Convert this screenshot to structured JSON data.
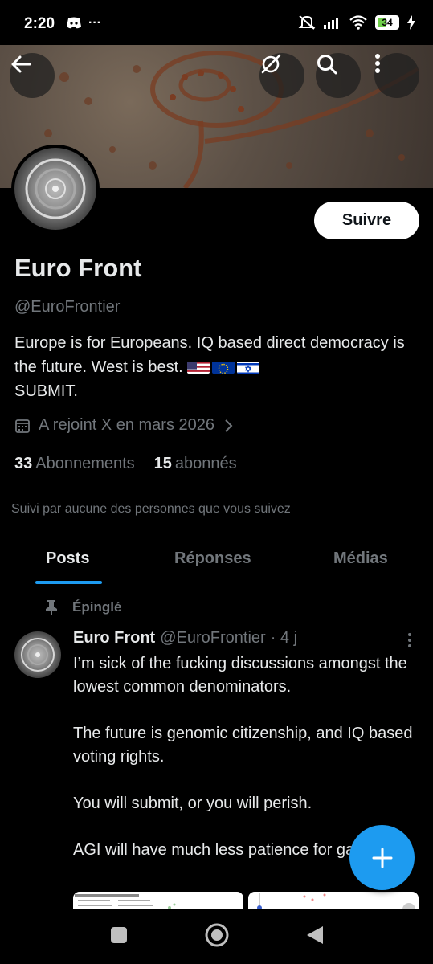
{
  "status_bar": {
    "time": "2:20",
    "more": "···",
    "battery": "34"
  },
  "profile": {
    "follow_label": "Suivre",
    "display_name": "Euro Front",
    "handle": "@EuroFrontier",
    "bio_text": "Europe is for Europeans. IQ based direct democracy is the future. West is best.",
    "bio_end": "SUBMIT.",
    "joined": "A rejoint X en mars 2026",
    "following_count": "33",
    "following_label": "Abonnements",
    "followers_count": "15",
    "followers_label": "abonnés",
    "followed_by": "Suivi par aucune des personnes que vous suivez"
  },
  "tabs": [
    {
      "label": "Posts",
      "active": true
    },
    {
      "label": "Réponses",
      "active": false
    },
    {
      "label": "Médias",
      "active": false
    }
  ],
  "pinned_post": {
    "pinned_label": "Épinglé",
    "author_name": "Euro Front",
    "author_handle": "@EuroFrontier",
    "time": "· 4 j",
    "paragraphs": [
      "I’m sick of the fucking discussions amongst the lowest common denominators.",
      "The future is genomic citizenship, and IQ based voting rights.",
      "You will submit, or you will perish.",
      "AGI will have much less patience for games."
    ]
  },
  "colors": {
    "accent": "#1d9bf0",
    "muted": "#71767b",
    "text": "#e7e9ea"
  }
}
